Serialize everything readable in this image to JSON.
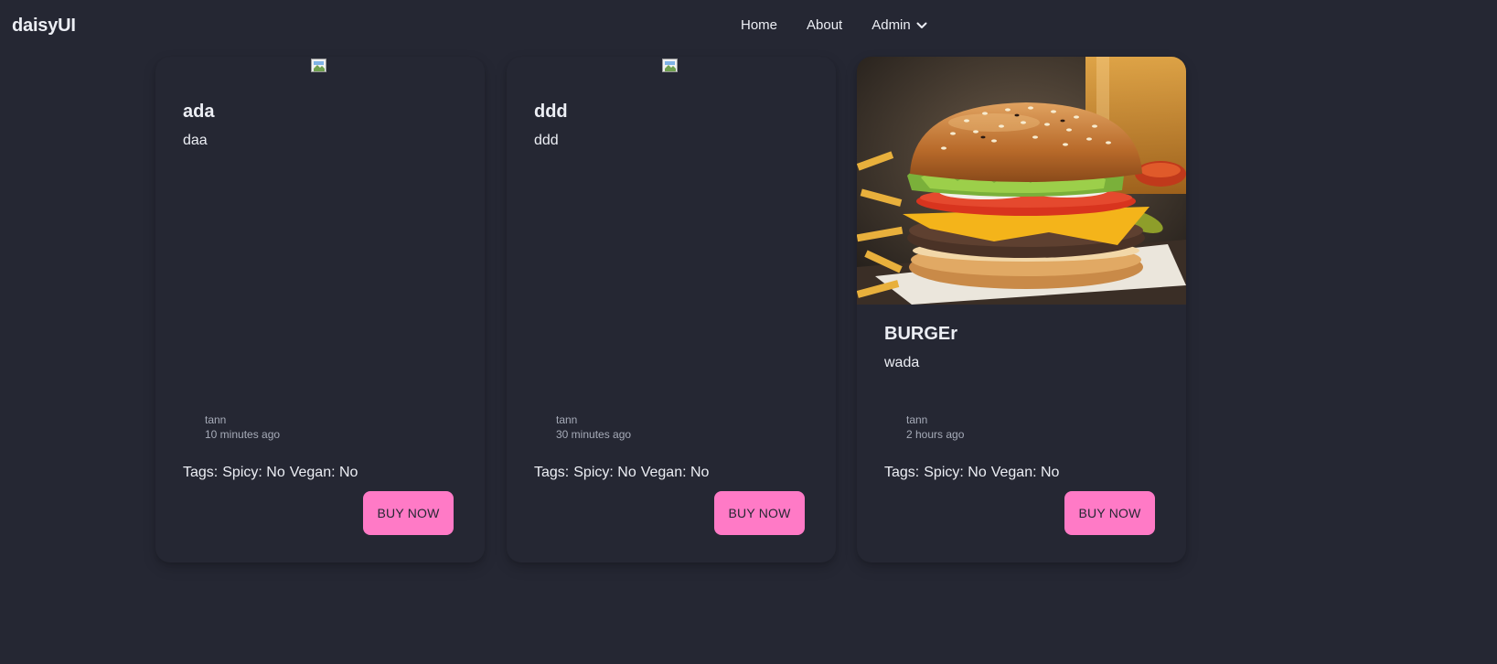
{
  "navbar": {
    "brand": "daisyUI",
    "links": [
      {
        "label": "Home"
      },
      {
        "label": "About"
      },
      {
        "label": "Admin"
      }
    ]
  },
  "cards": [
    {
      "title": "ada",
      "description": "daa",
      "author": "tann",
      "time": "10 minutes ago",
      "tags_label": "Tags:",
      "spicy": "Spicy: No",
      "vegan": "Vegan: No",
      "button": "BUY NOW",
      "image": "broken-image"
    },
    {
      "title": "ddd",
      "description": "ddd",
      "author": "tann",
      "time": "30 minutes ago",
      "tags_label": "Tags:",
      "spicy": "Spicy: No",
      "vegan": "Vegan: No",
      "button": "BUY NOW",
      "image": "broken-image"
    },
    {
      "title": "BURGEr",
      "description": "wada",
      "author": "tann",
      "time": "2 hours ago",
      "tags_label": "Tags:",
      "spicy": "Spicy: No",
      "vegan": "Vegan: No",
      "button": "BUY NOW",
      "image": "burger-photo"
    }
  ],
  "colors": {
    "background": "#252733",
    "accent": "#ff7ac6",
    "muted_text": "#a6abb8"
  }
}
